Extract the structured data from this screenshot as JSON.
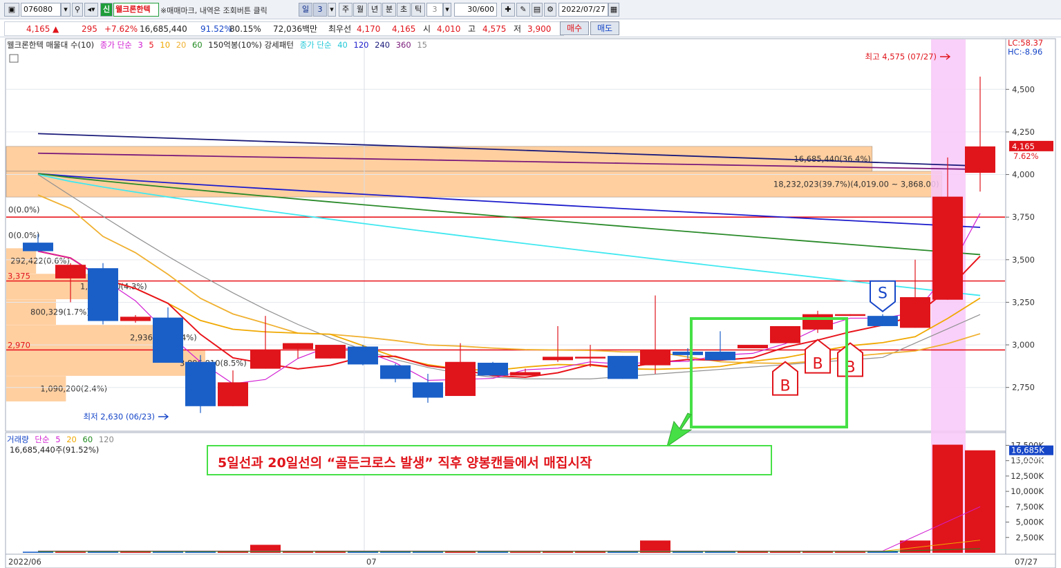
{
  "toolbar": {
    "code": "076080",
    "badge": "신",
    "name": "웰크론한텍",
    "notice": "※매매마크, 내역은 조회버튼 클릭",
    "period_tabs": [
      "일",
      "3",
      "주",
      "월",
      "년",
      "분",
      "초",
      "틱"
    ],
    "unit_value": "3",
    "count": "30/600",
    "date": "2022/07/27"
  },
  "info": {
    "price": "4,165",
    "arrow": "▲",
    "change": "295",
    "change_pct": "+7.62%",
    "volume": "16,685,440",
    "vol_ratio": "91.52%",
    "pct2": "80.15%",
    "amount": "72,036백만",
    "best_label": "최우선",
    "best_ask": "4,170",
    "best_bid": "4,165",
    "open_label": "시",
    "open": "4,010",
    "high_label": "고",
    "high": "4,575",
    "low_label": "저",
    "low": "3,900",
    "buy_button": "매수",
    "sell_button": "매도"
  },
  "legend": {
    "main_label": "웰크론한텍 매물대 수(10)",
    "ma_label": "종가 단순",
    "ma_periods": [
      "3",
      "5",
      "10",
      "20",
      "60"
    ],
    "pattern_label": "150억봉(10%) 강세패턴",
    "ma2_label": "종가 단순",
    "ma2_periods": [
      "40",
      "120",
      "240",
      "360",
      "15"
    ],
    "volume_label": "거래량",
    "vol_ma_label": "단순",
    "vol_periods": [
      "5",
      "20",
      "60",
      "120"
    ],
    "volume_info": "16,685,440주(91.52%)",
    "lc": "LC:58.37",
    "hc": "HC:-8.96"
  },
  "colors": {
    "up": "#e0141b",
    "down": "#1a5fc8",
    "ma3": "#d21ed2",
    "ma5": "#e8141b",
    "ma10": "#f0a800",
    "ma20": "#f0b030",
    "ma60": "#909090",
    "ma40": "#40e8f0",
    "ma120": "#1c1ccc",
    "ma240": "#2a8a2a",
    "ma360": "#7a1a7a",
    "ma15": "#1a1a7a",
    "profile": "#ffcfa0",
    "highlight": "#f8c8f8",
    "annotation_box": "#46e046"
  },
  "annotation": {
    "text": "5일선과 20일선의 “골든크로스 발생” 직후 양봉캔들에서 매집시작"
  },
  "chart_data": {
    "type": "candlestick",
    "x_labels": [
      "2022/06",
      "07",
      "07/27"
    ],
    "y_ticks": [
      "4,500",
      "4,250",
      "4,000",
      "3,750",
      "3,500",
      "3,250",
      "3,000",
      "2,750"
    ],
    "ylim": [
      2550,
      4700
    ],
    "candles": [
      {
        "o": 3600,
        "h": 3650,
        "l": 3550,
        "c": 3550
      },
      {
        "o": 3390,
        "h": 3480,
        "l": 3250,
        "c": 3470
      },
      {
        "o": 3450,
        "h": 3480,
        "l": 3120,
        "c": 3140
      },
      {
        "o": 3140,
        "h": 3175,
        "l": 3130,
        "c": 3165
      },
      {
        "o": 3160,
        "h": 3220,
        "l": 2895,
        "c": 2895
      },
      {
        "o": 2900,
        "h": 2940,
        "l": 2600,
        "c": 2640
      },
      {
        "o": 2640,
        "h": 2850,
        "l": 2640,
        "c": 2780
      },
      {
        "o": 2860,
        "h": 3170,
        "l": 2860,
        "c": 2970
      },
      {
        "o": 2975,
        "h": 3010,
        "l": 2920,
        "c": 3010
      },
      {
        "o": 2920,
        "h": 2990,
        "l": 2920,
        "c": 3000
      },
      {
        "o": 2990,
        "h": 3000,
        "l": 2880,
        "c": 2885
      },
      {
        "o": 2880,
        "h": 2890,
        "l": 2780,
        "c": 2800
      },
      {
        "o": 2780,
        "h": 2830,
        "l": 2660,
        "c": 2690
      },
      {
        "o": 2700,
        "h": 3010,
        "l": 2700,
        "c": 2900
      },
      {
        "o": 2895,
        "h": 2900,
        "l": 2820,
        "c": 2820
      },
      {
        "o": 2820,
        "h": 2860,
        "l": 2820,
        "c": 2840
      },
      {
        "o": 2910,
        "h": 3110,
        "l": 2900,
        "c": 2930
      },
      {
        "o": 2920,
        "h": 3000,
        "l": 2870,
        "c": 2930
      },
      {
        "o": 2935,
        "h": 2935,
        "l": 2800,
        "c": 2800
      },
      {
        "o": 2880,
        "h": 3290,
        "l": 2830,
        "c": 2970
      },
      {
        "o": 2960,
        "h": 2980,
        "l": 2920,
        "c": 2940
      },
      {
        "o": 2960,
        "h": 3080,
        "l": 2910,
        "c": 2910
      },
      {
        "o": 2980,
        "h": 3000,
        "l": 2980,
        "c": 3000
      },
      {
        "o": 3010,
        "h": 3110,
        "l": 3010,
        "c": 3110
      },
      {
        "o": 3090,
        "h": 3200,
        "l": 3070,
        "c": 3180
      },
      {
        "o": 3170,
        "h": 3180,
        "l": 3170,
        "c": 3180
      },
      {
        "o": 3170,
        "h": 3180,
        "l": 3110,
        "c": 3110
      },
      {
        "o": 3100,
        "h": 3500,
        "l": 3100,
        "c": 3280
      },
      {
        "o": 3265,
        "h": 4100,
        "l": 3265,
        "c": 3870
      },
      {
        "o": 4010,
        "h": 4575,
        "l": 3900,
        "c": 4165
      }
    ],
    "volume_ylim": [
      0,
      18000
    ],
    "volume_ticks": [
      "17,500K",
      "15,000K",
      "12,500K",
      "10,000K",
      "7,500K",
      "5,000K",
      "2,500K"
    ],
    "volume": [
      180,
      160,
      200,
      170,
      250,
      320,
      220,
      1300,
      260,
      300,
      240,
      200,
      180,
      320,
      180,
      160,
      300,
      220,
      180,
      2000,
      260,
      220,
      260,
      180,
      220,
      160,
      220,
      2000,
      17600,
      16685
    ],
    "price_lines": [
      3375,
      3750,
      2970
    ],
    "price_line_labels": [
      "3,375",
      "2,970"
    ],
    "volume_profile": [
      {
        "label": "16,685,440(36.4%)",
        "range": [
          4020,
          4165
        ],
        "width": 0.87
      },
      {
        "label": "18,232,023(39.7%)(4,019.00 ~ 3,868.00)",
        "range": [
          3868,
          4019
        ],
        "width": 0.94
      },
      {
        "label": "0(0.0%)",
        "range": [
          3718,
          3867
        ],
        "width": 0.0
      },
      {
        "label": "0(0.0%)",
        "range": [
          3568,
          3717
        ],
        "width": 0.0
      },
      {
        "label": "292,422(0.6%)",
        "range": [
          3418,
          3567
        ],
        "width": 0.03
      },
      {
        "label": "1,950,250(4.3%)",
        "range": [
          3268,
          3417
        ],
        "width": 0.1
      },
      {
        "label": "800,329(1.7%)",
        "range": [
          3118,
          3267
        ],
        "width": 0.05
      },
      {
        "label": "2,936,838(6.4%)",
        "range": [
          2968,
          3117
        ],
        "width": 0.15
      },
      {
        "label": "3,896,810(8.5%)",
        "range": [
          2818,
          2967
        ],
        "width": 0.2
      },
      {
        "label": "1,090,200(2.4%)",
        "range": [
          2668,
          2817
        ],
        "width": 0.06
      }
    ],
    "high_marker": "최고 4,575 (07/27)",
    "low_marker": "최저 2,630 (06/23)",
    "current_price_label": "4,165",
    "current_change_label": "7.62%",
    "volume_current_label": "16,685K",
    "volume_current_pct": "91.52%",
    "signals": [
      {
        "type": "S",
        "index": 26
      },
      {
        "type": "B",
        "index": 23
      },
      {
        "type": "B",
        "index": 24
      },
      {
        "type": "B",
        "index": 25
      }
    ]
  }
}
